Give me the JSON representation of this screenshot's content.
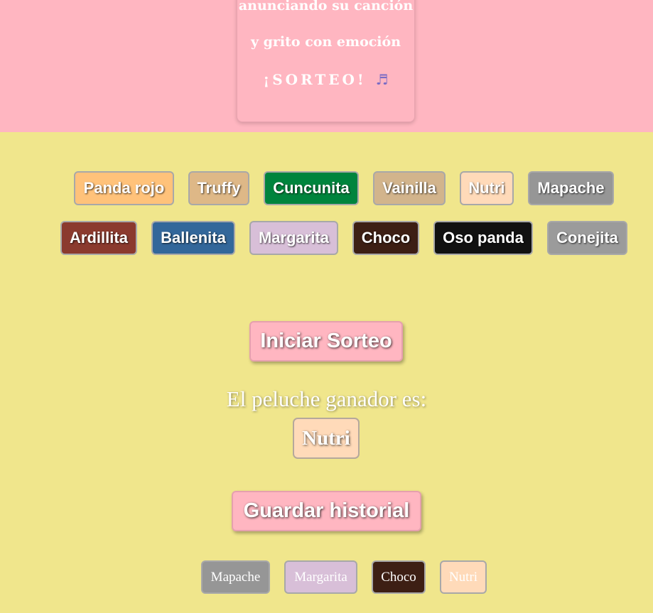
{
  "poem": {
    "line1": "anunciando su canción",
    "line2": "y grito con emoción",
    "line3": "¡SORTEO!",
    "icon": "music-notes-icon"
  },
  "plushies": [
    {
      "label": "Panda rojo",
      "color": "#ffc27a"
    },
    {
      "label": "Truffy",
      "color": "#deb887"
    },
    {
      "label": "Cuncunita",
      "color": "#00843d"
    },
    {
      "label": "Vainilla",
      "color": "#d2b48c"
    },
    {
      "label": "Nutri",
      "color": "#ffdab9"
    },
    {
      "label": "Mapache",
      "color": "#969696"
    },
    {
      "label": "Ardillita",
      "color": "#8b3a2e"
    },
    {
      "label": "Ballenita",
      "color": "#33679a"
    },
    {
      "label": "Margarita",
      "color": "#d8bfd8"
    },
    {
      "label": "Choco",
      "color": "#3d1f14"
    },
    {
      "label": "Oso panda",
      "color": "#111111"
    },
    {
      "label": "Conejita",
      "color": "#9b9b9b"
    }
  ],
  "actions": {
    "start_label": "Iniciar Sorteo",
    "save_label": "Guardar historial"
  },
  "result": {
    "label": "El peluche ganador es:",
    "winner": "Nutri",
    "winner_color": "#ffdab9"
  },
  "history": [
    {
      "label": "Mapache",
      "color": "#969696"
    },
    {
      "label": "Margarita",
      "color": "#d8bfd8"
    },
    {
      "label": "Choco",
      "color": "#3d1f14"
    },
    {
      "label": "Nutri",
      "color": "#ffdab9"
    }
  ]
}
